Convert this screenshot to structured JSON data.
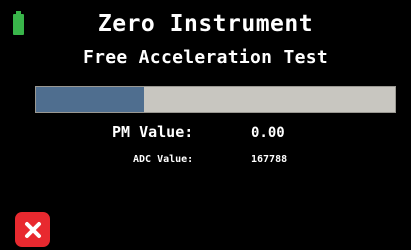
{
  "status": {
    "battery_icon": "battery-full-icon",
    "battery_color": "#39b54a",
    "battery_level": 1.0
  },
  "header": {
    "title": "Zero Instrument",
    "subtitle": "Free Acceleration Test"
  },
  "progress": {
    "value": 0.3,
    "fill_color": "#4f6e8f",
    "track_color": "#c8c6c0"
  },
  "readings": {
    "pm_label": "PM Value:",
    "pm_value": "0.00",
    "adc_label": "ADC Value:",
    "adc_value": "167788"
  },
  "actions": {
    "close_icon": "close-icon",
    "close_color": "#e8292f"
  }
}
